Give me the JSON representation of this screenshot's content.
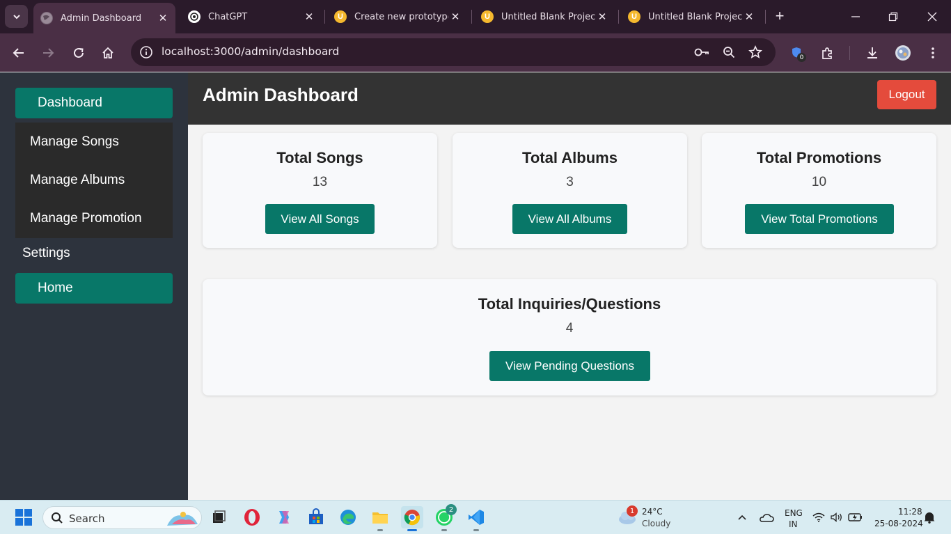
{
  "browser": {
    "tabs": [
      {
        "title": "Admin Dashboard",
        "active": true,
        "favicon": "globe-icon"
      },
      {
        "title": "ChatGPT",
        "active": false,
        "favicon": "chatgpt-icon"
      },
      {
        "title": "Create new prototype",
        "active": false,
        "favicon": "uizard-icon"
      },
      {
        "title": "Untitled Blank Project",
        "active": false,
        "favicon": "uizard-icon"
      },
      {
        "title": "Untitled Blank Project",
        "active": false,
        "favicon": "uizard-icon"
      }
    ],
    "url": "localhost:3000/admin/dashboard",
    "extension_badge": "0"
  },
  "sidebar": {
    "dashboard": "Dashboard",
    "submenu": [
      "Manage Songs",
      "Manage Albums",
      "Manage Promotion"
    ],
    "settings": "Settings",
    "home": "Home"
  },
  "header": {
    "title": "Admin Dashboard",
    "logout": "Logout"
  },
  "cards": [
    {
      "title": "Total Songs",
      "value": "13",
      "button": "View All Songs"
    },
    {
      "title": "Total Albums",
      "value": "3",
      "button": "View All Albums"
    },
    {
      "title": "Total Promotions",
      "value": "10",
      "button": "View Total Promotions"
    },
    {
      "title": "Total Inquiries/Questions",
      "value": "4",
      "button": "View Pending Questions"
    }
  ],
  "taskbar": {
    "search": "Search",
    "weather_temp": "24°C",
    "weather_desc": "Cloudy",
    "weather_badge": "1",
    "whatsapp_badge": "2",
    "lang_line1": "ENG",
    "lang_line2": "IN",
    "time": "11:28",
    "date": "25-08-2024"
  },
  "colors": {
    "accent_teal": "#087768",
    "logout_red": "#e44b3c",
    "sidebar_bg": "#2d333d",
    "header_bg": "#333333"
  }
}
